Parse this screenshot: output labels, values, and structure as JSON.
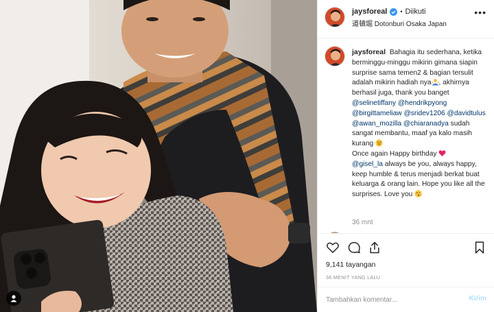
{
  "photo": {
    "description_icon": "person-tag-icon"
  },
  "header": {
    "username": "jaysforeal",
    "separator": "•",
    "follow_state": "Diikuti",
    "location": "道頓堀 Dotonburi Osaka Japan",
    "more_icon": "more-options-icon"
  },
  "caption": {
    "username": "jaysforeal",
    "seg1": "Bahagia itu sederhana, ketika berminggu-minggu mikirin gimana siapin surprise sama temen2 & bagian tersulit adalah mikirin hadiah nya",
    "seg2": ", akhirnya berhasil juga, thank you banget ",
    "mentions1": [
      "@selinetiffany",
      "@hendrikpyong",
      "@birgittameliaw",
      "@sridev1206",
      "@davidtulus",
      "@awan_mozilla",
      "@chiaranadya"
    ],
    "seg3": " sudah sangat membantu, maaf ya kalo masih kurang",
    "seg4": "Once again Happy birthday",
    "mention2": "@gisel_la",
    "seg5": " always be you, always happy, keep humble & terus menjadi berkat buat keluarga & orang lain. Hope you like all the surprises. Love you",
    "time": "36 mnt"
  },
  "actions": {
    "like_icon": "heart-icon",
    "comment_icon": "comment-icon",
    "share_icon": "share-icon",
    "save_icon": "bookmark-icon"
  },
  "stats": {
    "views": "9,141 tayangan",
    "ago": "36 MENIT YANG LALU"
  },
  "comment_box": {
    "placeholder": "Tambahkan komentar...",
    "post_label": "Kirim"
  },
  "colors": {
    "mention": "#003569",
    "muted": "#8e8e8e",
    "verified": "#3897f0",
    "post_disabled": "#b2dffc"
  }
}
